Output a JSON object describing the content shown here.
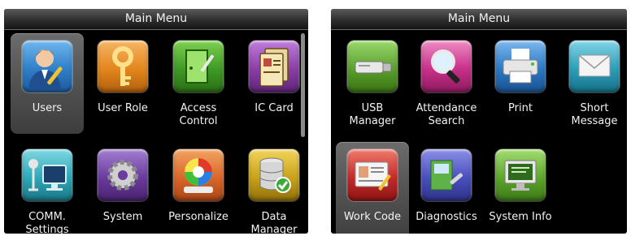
{
  "left_screen": {
    "title": "Main Menu",
    "items": [
      {
        "label": "Users",
        "icon": "users-icon",
        "color": "#2f7fc8"
      },
      {
        "label": "User Role",
        "icon": "key-icon",
        "color": "#e3861d"
      },
      {
        "label": "Access\nControl",
        "icon": "access-control-icon",
        "color": "#3f9a25"
      },
      {
        "label": "IC Card",
        "icon": "ic-card-icon",
        "color": "#8a3fa8"
      },
      {
        "label": "COMM.\nSettings",
        "icon": "network-icon",
        "color": "#2ea9b8"
      },
      {
        "label": "System",
        "icon": "gear-icon",
        "color": "#6b3b9e"
      },
      {
        "label": "Personalize",
        "icon": "color-wheel-icon",
        "color": "#d9672a"
      },
      {
        "label": "Data\nManager",
        "icon": "database-icon",
        "color": "#c9a21a"
      }
    ]
  },
  "right_screen": {
    "title": "Main Menu",
    "items": [
      {
        "label": "USB\nManager",
        "icon": "usb-drive-icon",
        "color": "#5aa02c"
      },
      {
        "label": "Attendance\nSearch",
        "icon": "magnifier-icon",
        "color": "#c8308a"
      },
      {
        "label": "Print",
        "icon": "printer-icon",
        "color": "#2b78c4"
      },
      {
        "label": "Short\nMessage",
        "icon": "envelope-icon",
        "color": "#2a9fba"
      },
      {
        "label": "Work Code",
        "icon": "id-card-icon",
        "color": "#c62a2a"
      },
      {
        "label": "Diagnostics",
        "icon": "diagnostics-icon",
        "color": "#4a4fc0"
      },
      {
        "label": "System Info",
        "icon": "system-info-icon",
        "color": "#5ca82c"
      }
    ]
  }
}
